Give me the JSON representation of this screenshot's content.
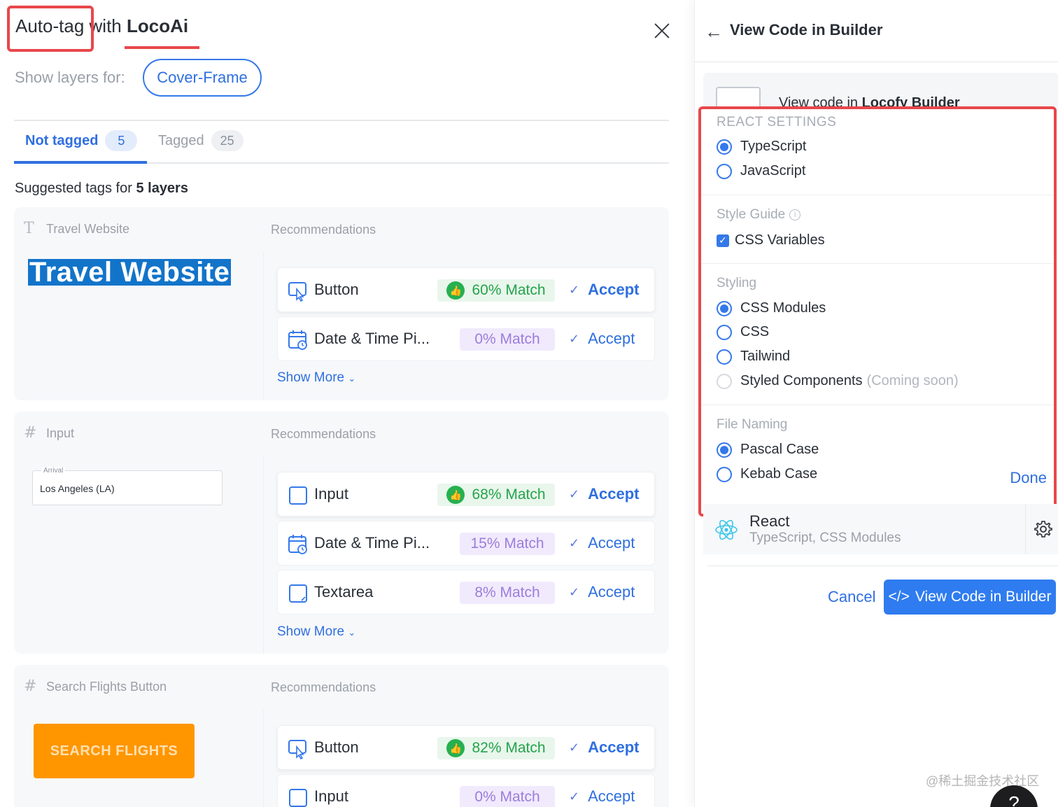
{
  "left_panel": {
    "title_prefix": "Auto-tag",
    "title_middle": " with ",
    "title_brand": "LocoAi",
    "show_layers_label": "Show layers for:",
    "frame_pill": "Cover-Frame",
    "tabs": [
      {
        "label": "Not tagged",
        "count": "5"
      },
      {
        "label": "Tagged",
        "count": "25"
      }
    ],
    "suggested_prefix": "Suggested tags for ",
    "suggested_bold": "5 layers",
    "recommendations_label": "Recommendations",
    "show_more": "Show More",
    "accept": "Accept",
    "cards": [
      {
        "layer_icon": "text-icon",
        "layer_name": "Travel Website",
        "preview_text": "Travel Website",
        "recs": [
          {
            "name": "Button",
            "match": "60% Match",
            "icon": "button-cursor-icon"
          },
          {
            "name": "Date & Time Pi...",
            "match": "0% Match",
            "icon": "calendar-icon"
          }
        ]
      },
      {
        "layer_icon": "frame-icon",
        "layer_name": "Input",
        "preview_label": "Arrival",
        "preview_value": "Los Angeles (LA)",
        "recs": [
          {
            "name": "Input",
            "match": "68% Match",
            "icon": "input-icon"
          },
          {
            "name": "Date & Time Pi...",
            "match": "15% Match",
            "icon": "calendar-icon"
          },
          {
            "name": "Textarea",
            "match": "8% Match",
            "icon": "textarea-icon"
          }
        ]
      },
      {
        "layer_icon": "frame-icon",
        "layer_name": "Search Flights Button",
        "preview_button": "SEARCH FLIGHTS",
        "recs": [
          {
            "name": "Button",
            "match": "82% Match",
            "icon": "button-cursor-icon"
          },
          {
            "name": "Input",
            "match": "0% Match",
            "icon": "input-icon"
          }
        ]
      }
    ]
  },
  "right_panel": {
    "title": "View Code in Builder",
    "banner_prefix": "View code in ",
    "banner_bold": "Locofy Builder",
    "react_settings": {
      "title": "REACT SETTINGS",
      "options": [
        "TypeScript",
        "JavaScript"
      ],
      "selected": "TypeScript"
    },
    "style_guide": {
      "title": "Style Guide",
      "checkbox_label": "CSS Variables",
      "checked": true
    },
    "styling": {
      "title": "Styling",
      "options": [
        "CSS Modules",
        "CSS",
        "Tailwind",
        "Styled Components"
      ],
      "coming_soon": "(Coming soon)",
      "selected": "CSS Modules"
    },
    "file_naming": {
      "title": "File Naming",
      "options": [
        "Pascal Case",
        "Kebab Case"
      ],
      "selected": "Pascal Case"
    },
    "done": "Done",
    "framework": {
      "name": "React",
      "summary": "TypeScript, CSS Modules"
    },
    "cancel": "Cancel",
    "primary_button": "View Code in Builder",
    "watermark": "@稀土掘金技术社区"
  },
  "colors": {
    "accent": "#2f6fe0",
    "highlight_red": "#e8474b",
    "match_good": "#23a44a",
    "match_low": "#9b7ddb",
    "search_button": "#ff9600"
  }
}
